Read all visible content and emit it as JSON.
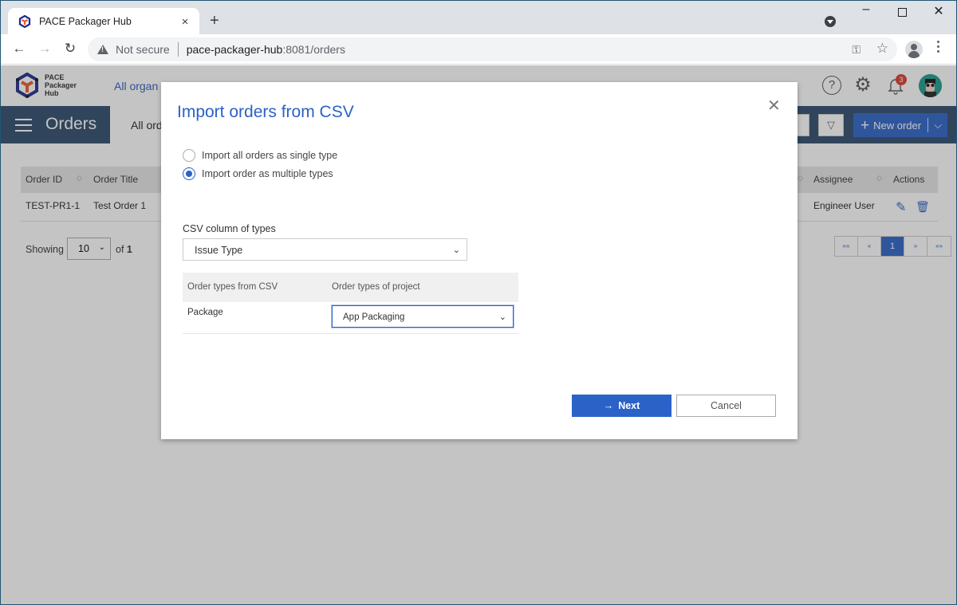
{
  "browser": {
    "tab_title": "PACE Packager Hub",
    "tab_close": "×",
    "new_tab": "+",
    "security_label": "Not secure",
    "url_host": "pace-packager-hub",
    "url_rest": ":8081/orders",
    "window_controls": {
      "minimize": "–",
      "close": "✕"
    }
  },
  "app": {
    "logo_lines": [
      "PACE",
      "Packager",
      "Hub"
    ],
    "org_link": "All organ",
    "notifications_count": "3",
    "help_glyph": "?",
    "gear_glyph": "⚙",
    "section_title": "Orders",
    "view_tab": "All ord",
    "new_order_label": "New order",
    "new_order_plus": "+",
    "new_order_chevron": "⌵",
    "filter_glyph": "▽"
  },
  "grid": {
    "columns": [
      {
        "label": "Order ID"
      },
      {
        "label": "Order Title"
      },
      {
        "label": "Assignee"
      },
      {
        "label": "Actions"
      }
    ],
    "rows": [
      {
        "order_id": "TEST-PR1-1",
        "order_title": "Test Order 1",
        "assignee": "Engineer User"
      }
    ],
    "sort_glyph": "◇",
    "edit_glyph": "✎",
    "delete_glyph": "🗑"
  },
  "pagination": {
    "showing_label": "Showing",
    "page_size": "10",
    "page_size_chevron": "⌄",
    "of_label": "of",
    "total_pages": "1",
    "pages": [
      "««",
      "«",
      "1",
      "»",
      "»»"
    ],
    "current_page": "1"
  },
  "modal": {
    "title": "Import orders from CSV",
    "close_glyph": "✕",
    "options": [
      {
        "label": "Import all orders as single type",
        "checked": false
      },
      {
        "label": "Import order as multiple types",
        "checked": true
      }
    ],
    "csv_column_label": "CSV column of types",
    "csv_column_value": "Issue Type",
    "mapping": {
      "headers": [
        "Order types from CSV",
        "Order types of project"
      ],
      "rows": [
        {
          "csv_type": "Package",
          "project_type": "App Packaging"
        }
      ]
    },
    "select_chevron": "⌄",
    "next_label": "Next",
    "next_arrow": "→",
    "cancel_label": "Cancel"
  },
  "colors": {
    "primary": "#2a62c8",
    "nav_bar": "#2c4a6b",
    "badge": "#d93a2b"
  }
}
